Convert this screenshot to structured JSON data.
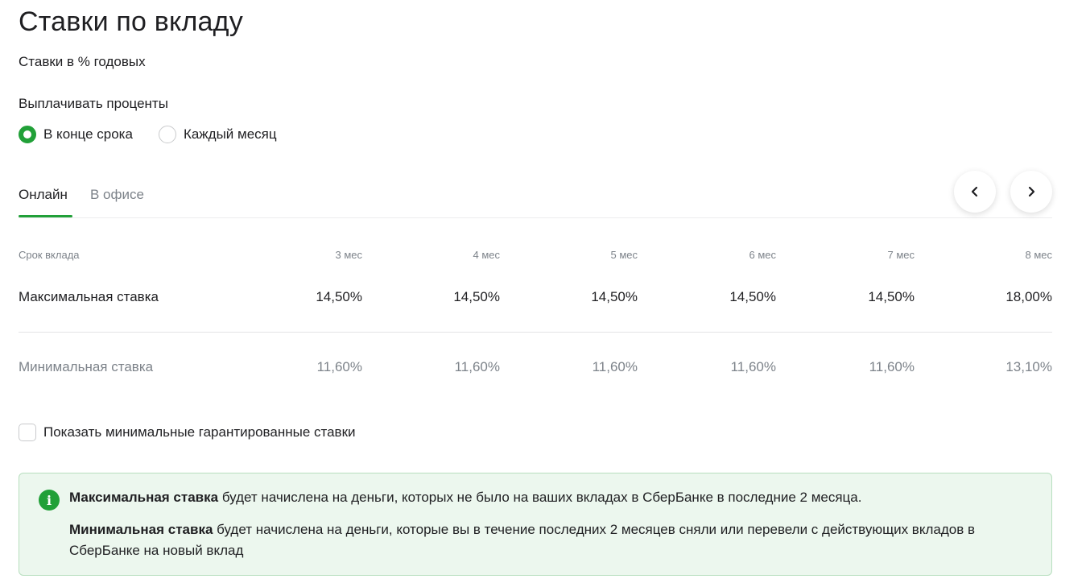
{
  "title": "Ставки по вкладу",
  "subtitle": "Ставки в % годовых",
  "payout": {
    "label": "Выплачивать проценты",
    "options": [
      "В конце срока",
      "Каждый месяц"
    ],
    "selected": "В конце срока"
  },
  "tabs": [
    "Онлайн",
    "В офисе"
  ],
  "active_tab": "Онлайн",
  "table": {
    "header_label": "Срок вклада",
    "terms": [
      "3 мес",
      "4 мес",
      "5 мес",
      "6 мес",
      "7 мес",
      "8 мес"
    ],
    "max_label": "Максимальная ставка",
    "max_rates": [
      "14,50%",
      "14,50%",
      "14,50%",
      "14,50%",
      "14,50%",
      "18,00%"
    ],
    "min_label": "Минимальная ставка",
    "min_rates": [
      "11,60%",
      "11,60%",
      "11,60%",
      "11,60%",
      "11,60%",
      "13,10%"
    ]
  },
  "checkbox": {
    "label": "Показать минимальные гарантированные ставки",
    "checked": false
  },
  "info": {
    "p1_bold": "Максимальная ставка",
    "p1_text": " будет начислена на деньги, которых не было на ваших вкладах в СберБанке в последние 2 месяца.",
    "p2_bold": "Минимальная ставка",
    "p2_text": " будет начислена на деньги, которые вы в течение последних 2 месяцев сняли или перевели с действующих вкладов в СберБанке на новый вклад"
  },
  "colors": {
    "accent": "#21a038",
    "info_bg": "#ecf7ee",
    "muted_text": "#7d838a"
  },
  "icons": {
    "prev": "chevron-left-icon",
    "next": "chevron-right-icon",
    "info": "info-icon"
  }
}
